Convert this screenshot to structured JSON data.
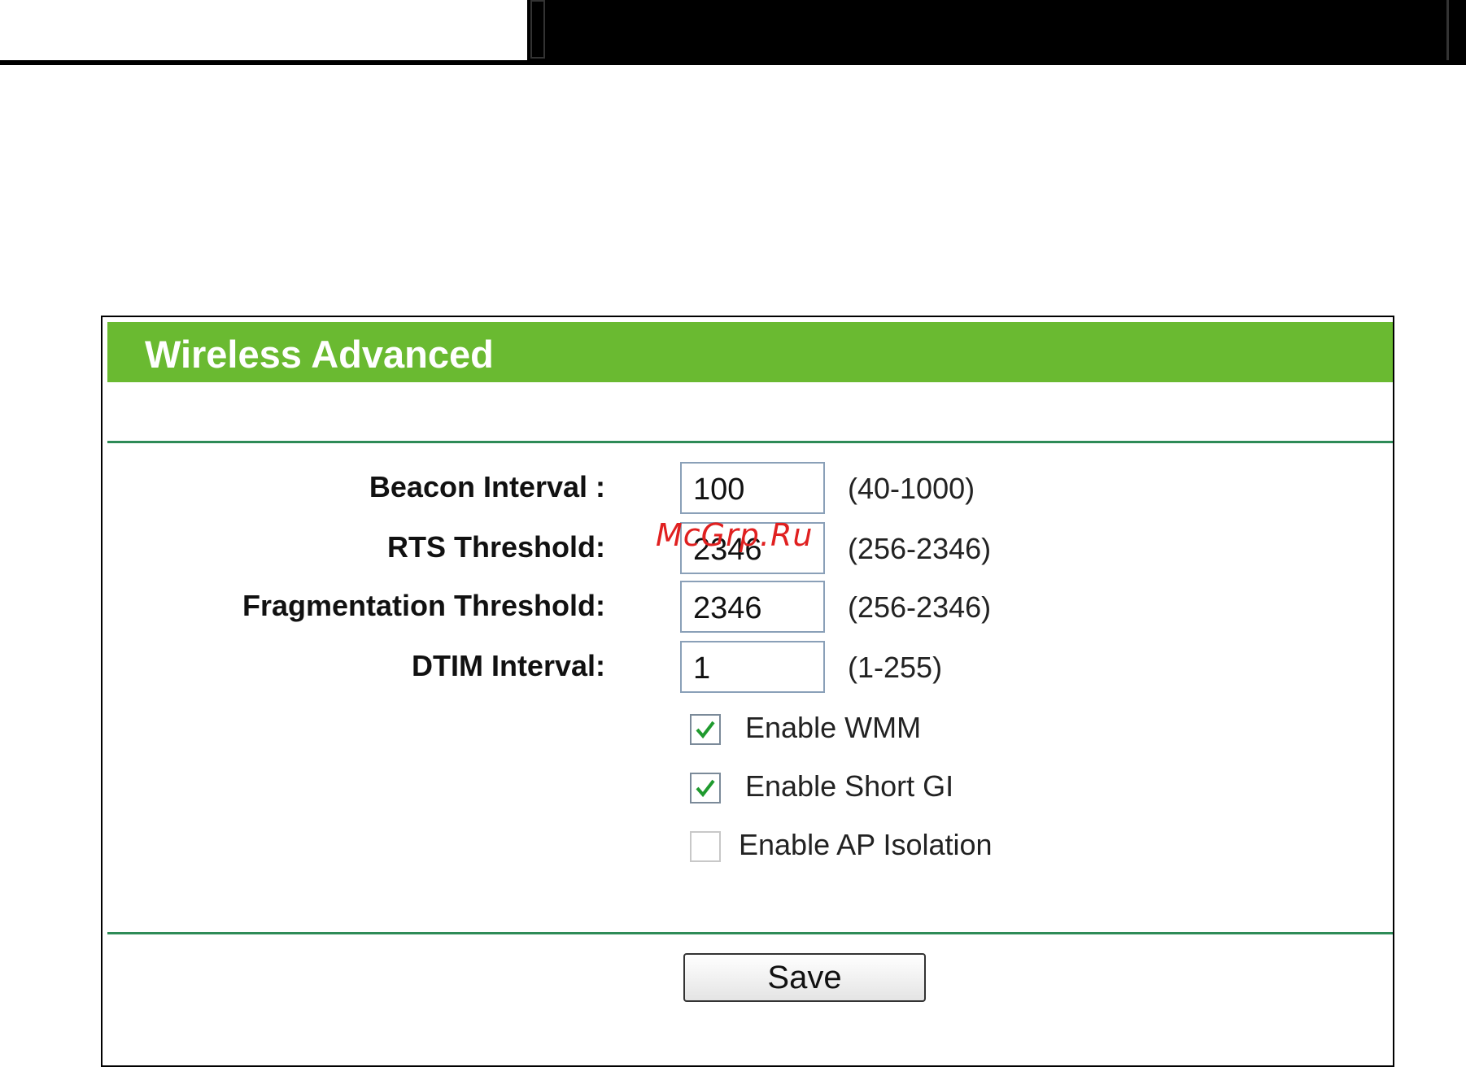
{
  "panel": {
    "title": "Wireless Advanced",
    "accent_color": "#6aba31",
    "divider_color": "#2e8b57"
  },
  "fields": [
    {
      "label": "Beacon Interval :",
      "value": "100",
      "hint": "(40-1000)"
    },
    {
      "label": "RTS Threshold:",
      "value": "2346",
      "hint": "(256-2346)"
    },
    {
      "label": "Fragmentation Threshold:",
      "value": "2346",
      "hint": "(256-2346)"
    },
    {
      "label": "DTIM Interval:",
      "value": "1",
      "hint": "(1-255)"
    }
  ],
  "checkboxes": [
    {
      "label": "Enable WMM",
      "checked": true
    },
    {
      "label": "Enable Short GI",
      "checked": true
    },
    {
      "label": "Enable AP Isolation",
      "checked": false
    }
  ],
  "save_label": "Save",
  "watermark": "McGrp.Ru"
}
